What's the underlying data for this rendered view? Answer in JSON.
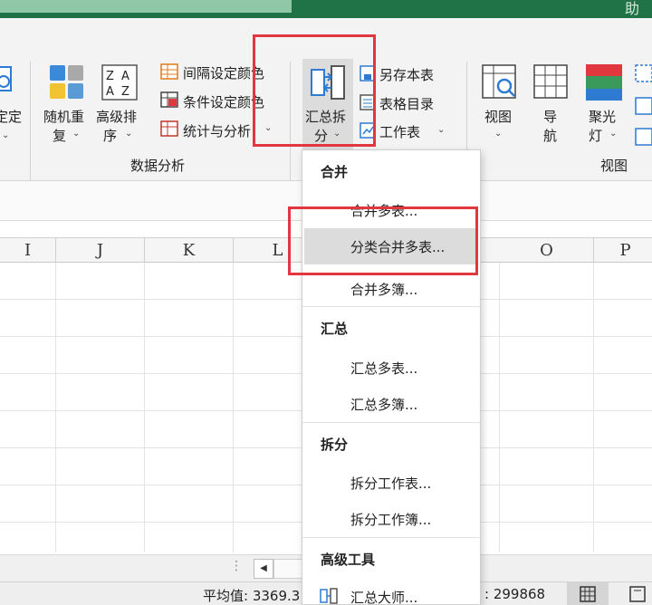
{
  "title_bar": {
    "corner_glyph": "助"
  },
  "ribbon": {
    "partial_left_label": "定定",
    "random_repeat": {
      "line1": "随机重",
      "line2": "复"
    },
    "advanced_sort": {
      "line1": "高级排",
      "line2": "序"
    },
    "interval_color": "间隔设定颜色",
    "condition_color": "条件设定颜色",
    "stats_analysis": "统计与分析",
    "group_data_analysis": "数据分析",
    "summarize_split": {
      "line1": "汇总拆",
      "line2": "分"
    },
    "save_this_sheet": "另存本表",
    "table_directory": "表格目录",
    "worksheet": "工作表",
    "view": "视图",
    "navigate": {
      "line1": "导",
      "line2": "航"
    },
    "spotlight": {
      "line1": "聚光",
      "line2": "灯"
    },
    "group_view": "视图"
  },
  "columns": [
    "I",
    "J",
    "K",
    "L",
    "O",
    "P"
  ],
  "menu": {
    "sections": [
      {
        "header": "合并",
        "items": [
          "合并多表...",
          "分类合并多表...",
          "合并多簿..."
        ]
      },
      {
        "header": "汇总",
        "items": [
          "汇总多表...",
          "汇总多簿..."
        ]
      },
      {
        "header": "拆分",
        "items": [
          "拆分工作表...",
          "拆分工作簿..."
        ]
      },
      {
        "header": "高级工具",
        "items": [
          "汇总大师..."
        ]
      }
    ],
    "highlighted_item": "分类合并多表..."
  },
  "status_bar": {
    "average_label": "平均值: 3369.3",
    "sum_value": ": 299868"
  },
  "colors": {
    "accent_green": "#1f7346",
    "annotation_red": "#e0383e",
    "menu_highlight": "#dcdcdc"
  }
}
